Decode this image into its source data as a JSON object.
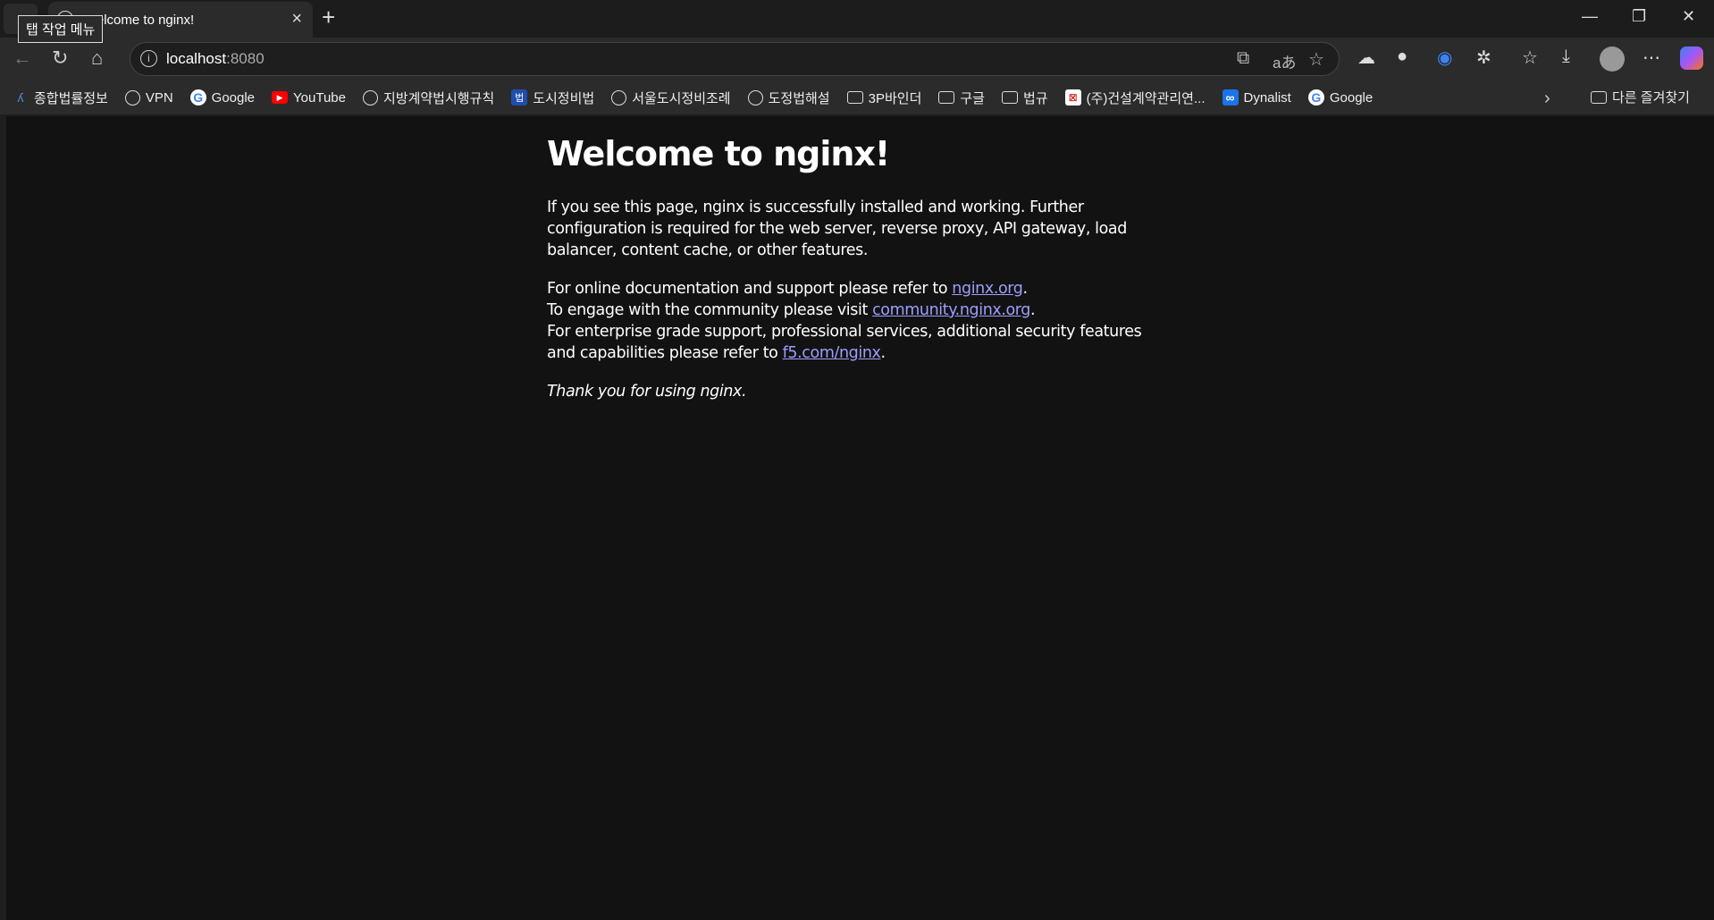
{
  "browser": {
    "tab_title": "Welcome to nginx!",
    "tooltip": "탭 작업 메뉴",
    "url_host": "localhost",
    "url_port": ":8080",
    "bookmarks": [
      {
        "label": "종합법률정보",
        "icon": "law-logo-icon"
      },
      {
        "label": "VPN",
        "icon": "globe-icon"
      },
      {
        "label": "Google",
        "icon": "google-icon"
      },
      {
        "label": "YouTube",
        "icon": "youtube-icon"
      },
      {
        "label": "지방계약법시행규칙",
        "icon": "globe-icon"
      },
      {
        "label": "도시정비법",
        "icon": "law-icon"
      },
      {
        "label": "서울도시정비조례",
        "icon": "globe-icon"
      },
      {
        "label": "도정법해설",
        "icon": "globe-icon"
      },
      {
        "label": "3P바인더",
        "icon": "folder-icon"
      },
      {
        "label": "구글",
        "icon": "folder-icon"
      },
      {
        "label": "법규",
        "icon": "folder-icon"
      },
      {
        "label": "(주)건설계약관리연...",
        "icon": "site-icon"
      },
      {
        "label": "Dynalist",
        "icon": "dynalist-icon"
      },
      {
        "label": "Google",
        "icon": "google-icon"
      }
    ],
    "other_favorites": "다른 즐겨찾기"
  },
  "page": {
    "heading": "Welcome to nginx!",
    "p1": [
      "If you see this page, nginx is successfully installed and working. Further",
      "configuration is required for the web server, reverse proxy, API gateway, load",
      "balancer, content cache, or other features."
    ],
    "p2": {
      "l1_pre": "For online documentation and support please refer to ",
      "l1_link": "nginx.org",
      "l1_post": ".",
      "l2_pre": "To engage with the community please visit ",
      "l2_link": "community.nginx.org",
      "l2_post": ".",
      "l3": "For enterprise grade support, professional services, additional security features",
      "l4_pre": "and capabilities please refer to ",
      "l4_link": "f5.com/nginx",
      "l4_post": "."
    },
    "thanks": "Thank you for using nginx."
  },
  "colors": {
    "link": "#9e9eff",
    "background": "#121212"
  }
}
